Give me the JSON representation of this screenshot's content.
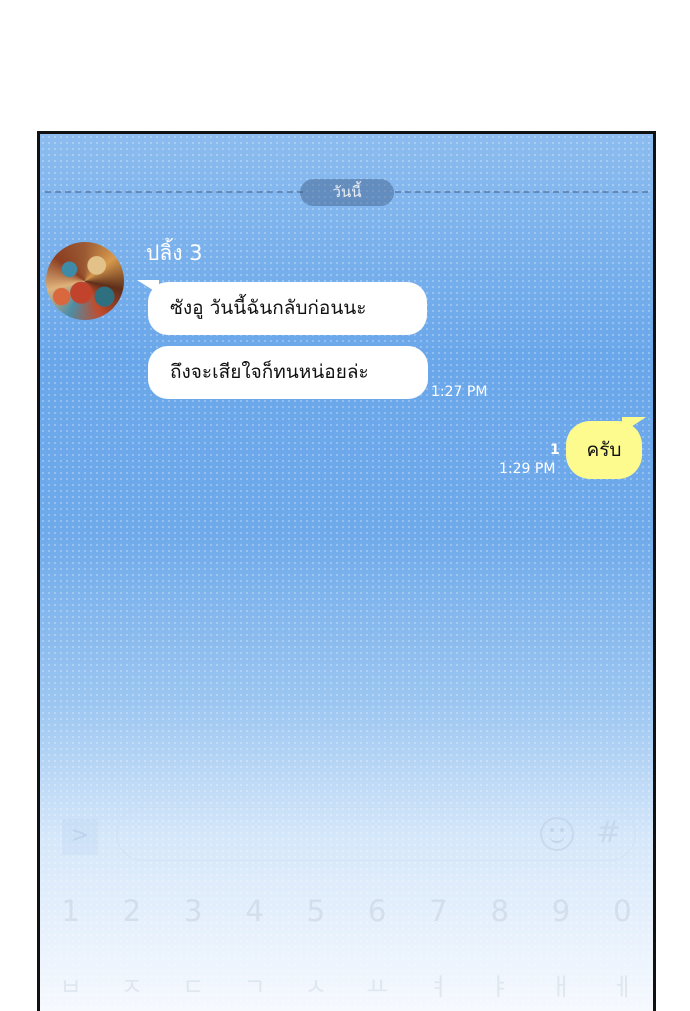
{
  "date_divider": "วันนี้",
  "chat": {
    "sender_name": "ปลิ้ง 3",
    "incoming": [
      "ซังอู วันนี้ฉันกลับก่อนนะ",
      "ถึงจะเสียใจก็ทนหน่อยล่ะ"
    ],
    "incoming_time": "1:27 PM",
    "outgoing": "ครับ",
    "outgoing_read": "1",
    "outgoing_time": "1:29 PM"
  },
  "input_bar": {
    "send_glyph": ">",
    "hash_glyph": "#",
    "icons": [
      "send-icon",
      "emoji-icon",
      "hashtag-icon"
    ]
  },
  "keyboard": {
    "numbers": [
      "1",
      "2",
      "3",
      "4",
      "5",
      "6",
      "7",
      "8",
      "9",
      "0"
    ],
    "chars": [
      "ㅂ",
      "ㅈ",
      "ㄷ",
      "ㄱ",
      "ㅅ",
      "ㅛ",
      "ㅕ",
      "ㅑ",
      "ㅐ",
      "ㅔ"
    ]
  },
  "colors": {
    "bg_top": "#8cbcef",
    "bg_mid": "#6aa7ea",
    "incoming_bubble": "#ffffff",
    "outgoing_bubble": "#fdfb8d",
    "frame": "#111111"
  }
}
